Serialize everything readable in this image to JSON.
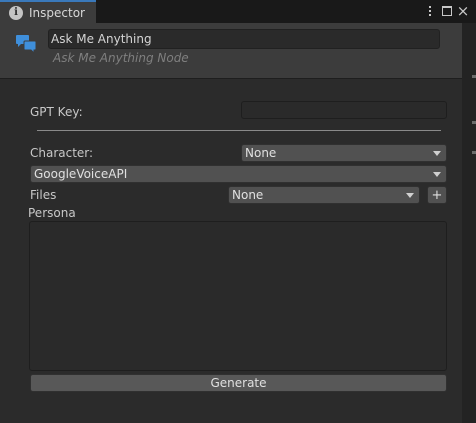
{
  "tab": {
    "title": "Inspector"
  },
  "node": {
    "name": "Ask Me Anything",
    "subtitle": "Ask Me Anything Node"
  },
  "fields": {
    "gpt_key_label": "GPT Key:",
    "gpt_key_value": "",
    "character_label": "Character:",
    "character_value": "None",
    "voice_value": "GoogleVoiceAPI",
    "files_label": "Files",
    "files_value": "None",
    "add_symbol": "+",
    "persona_label": "Persona",
    "persona_value": ""
  },
  "actions": {
    "generate_label": "Generate"
  },
  "window_controls": {
    "close_symbol": "×"
  },
  "icons": {
    "tab_icon": "info-icon",
    "header_icon": "chat-bubbles-icon"
  },
  "colors": {
    "accent": "#3a79bb",
    "chat_icon": "#3f8fdb"
  }
}
